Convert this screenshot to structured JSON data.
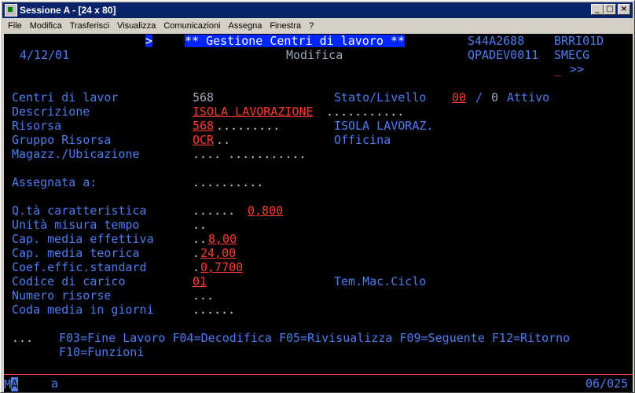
{
  "window": {
    "title": "Sessione A - [24 x 80]",
    "buttons": {
      "minimize": "_",
      "maximize": "□",
      "close": "×"
    }
  },
  "menu": [
    "File",
    "Modifica",
    "Trasferisci",
    "Visualizza",
    "Comunicazioni",
    "Assegna",
    "Finestra",
    "?"
  ],
  "header": {
    "arrow": ">",
    "title": "** Gestione Centri di lavoro **",
    "program_id": "S44A2688",
    "user": "BRRI01D",
    "date": "4/12/01",
    "mode": "Modifica",
    "job": "QPADEV0011",
    "system": "SMECG",
    "more": ">>"
  },
  "fields": {
    "centri_label": "Centri di lavor",
    "centri_value": "568",
    "stato_label": "Stato/Livello",
    "stato_value": "00",
    "stato_sep": "/",
    "livello_value": "0",
    "stato_text": "Attivo",
    "descrizione_label": "Descrizione",
    "descrizione_value": "ISOLA LAVORAZIONE",
    "risorsa_label": "Risorsa",
    "risorsa_value": "568",
    "risorsa_desc": "ISOLA LAVORAZ.",
    "gruppo_label": "Gruppo Risorsa",
    "gruppo_value": "OCR",
    "gruppo_desc": "Officina",
    "magazz_label": "Magazz./Ubicazione",
    "assegnata_label": "Assegnata a:",
    "qta_label": "Q.tà caratteristica",
    "qta_value": "0,800",
    "unita_label": "Unità misura tempo",
    "cap_eff_label": "Cap. media effettiva",
    "cap_eff_value": "8,00",
    "cap_teo_label": "Cap. media teorica",
    "cap_teo_value": "24,00",
    "coef_label": "Coef.effic.standard",
    "coef_value": "0,7700",
    "codice_label": "Codice di carico",
    "codice_value": "01",
    "tem_label": "Tem.Mac.Ciclo",
    "numero_label": "Numero risorse",
    "coda_label": "Coda media in giorni"
  },
  "fkeys": {
    "line1": "F03=Fine Lavoro F04=Decodifica F05=Rivisualizza F09=Seguente F12=Ritorno",
    "line2": "F10=Funzioni"
  },
  "status": {
    "indicator": "MA",
    "cursor_char": "A",
    "mode": "a",
    "position": "06/025"
  }
}
